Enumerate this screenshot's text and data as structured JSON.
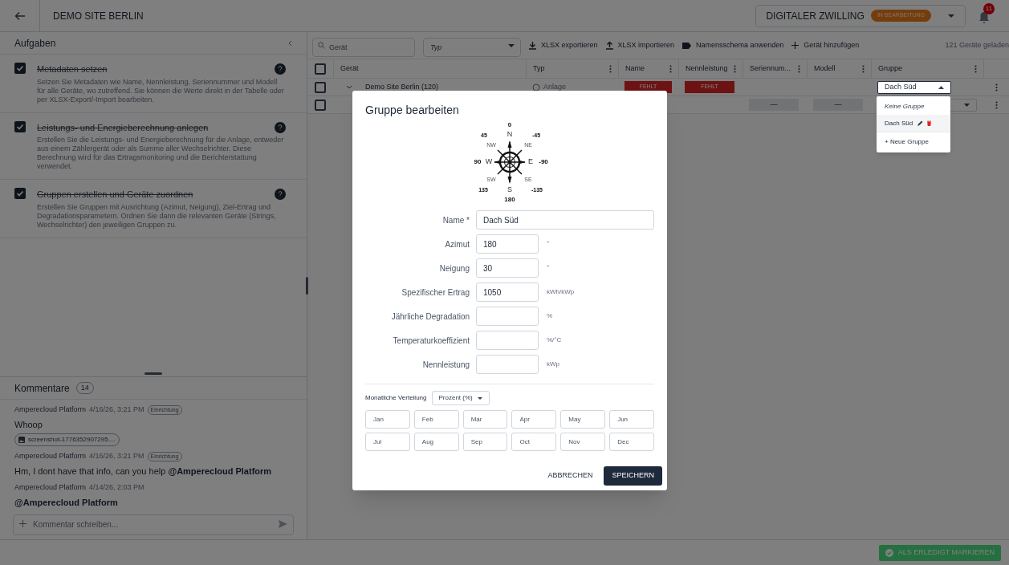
{
  "header": {
    "title": "DEMO SITE BERLIN",
    "twin_label": "DIGITALER ZWILLING",
    "twin_status": "IN BEARBEITUNG",
    "notifications": "11"
  },
  "tasks": {
    "title": "Aufgaben",
    "items": [
      {
        "title": "Metadaten setzen",
        "checked": true,
        "description": "Setzen Sie Metadaten wie Name, Nennleistung, Seriennummer und Modell für alle Geräte, wo zutreffend. Sie können die Werte direkt in der Tabelle oder per XLSX-Export/-Import bearbeiten."
      },
      {
        "title": "Leistungs- und Energieberechnung anlegen",
        "checked": true,
        "description": "Erstellen Sie die Leistungs- und Energieberechnung für die Anlage, entweder aus einem Zählergerät oder als Summe aller Wechselrichter. Diese Berechnung wird für das Ertragsmonitoring und die Berichterstattung verwendet."
      },
      {
        "title": "Gruppen erstellen und Geräte zuordnen",
        "checked": true,
        "description": "Erstellen Sie Gruppen mit Ausrichtung (Azimut, Neigung), Ziel-Ertrag und Degradationsparametern. Ordnen Sie dann die relevanten Geräte (Strings, Wechselrichter) den jeweiligen Gruppen zu."
      }
    ]
  },
  "comments": {
    "title": "Kommentare",
    "count": "14",
    "items": [
      {
        "author": "Amperecloud Platform",
        "time": "4/16/26, 3:21 PM",
        "tag": "Einrichtung",
        "text": "Whoop",
        "attachment": "screenshot-1776352907295...."
      },
      {
        "author": "Amperecloud Platform",
        "time": "4/16/26, 3:21 PM",
        "tag": "Einrichtung",
        "text": "Hm, I dont have that info, can you help **@Amperecloud Platform**"
      },
      {
        "author": "Amperecloud Platform",
        "time": "4/14/26, 2:03 PM",
        "text": "**@Amperecloud Platform**"
      }
    ],
    "input": {
      "placeholder": "Kommentar schreiben..."
    }
  },
  "toolbar": {
    "search": {
      "placeholder": "Gerät"
    },
    "type_filter": {
      "placeholder": "Typ"
    },
    "actions": [
      "XLSX exportieren",
      "XLSX importieren",
      "Namensschema anwenden",
      "Gerät hinzufügen"
    ],
    "status": "121 Geräte geladen"
  },
  "table": {
    "all_checked": false,
    "columns": [
      "Gerät",
      "Typ",
      "Name",
      "Nennleistung",
      "Seriennum...",
      "Modell",
      "Gruppe"
    ],
    "rows": [
      {
        "device": "Demo Site Berlin (120)",
        "type": "Anlage",
        "name": "FEHLT",
        "power": "FEHLT",
        "group": "Dach Süd",
        "checked": false
      },
      {
        "serial": "—",
        "model": "—",
        "checked": false
      }
    ]
  },
  "group_menu": {
    "items": [
      {
        "label": "Keine Gruppe",
        "kind": "none"
      },
      {
        "label": "Dach Süd",
        "kind": "group"
      },
      {
        "label": "+ Neue Gruppe",
        "kind": "add"
      }
    ]
  },
  "dialog": {
    "title": "Gruppe bearbeiten",
    "compass_labels": [
      "0",
      "45",
      "N",
      "-45",
      "NW",
      "NE",
      "90",
      "W",
      "E",
      "-90",
      "SW",
      "SE",
      "135",
      "S",
      "-135",
      "180"
    ],
    "fields": [
      {
        "label": "Name *",
        "value": "Dach Süd",
        "kind": "wide"
      },
      {
        "label": "Azimut",
        "value": "180",
        "unit": "°"
      },
      {
        "label": "Neigung",
        "value": "30",
        "unit": "°"
      },
      {
        "label": "Spezifischer Ertrag",
        "value": "1050",
        "unit": "kWh/kWp"
      },
      {
        "label": "Jährliche Degradation",
        "unit": "%"
      },
      {
        "label": "Temperaturkoeffizient",
        "unit": "%/°C"
      },
      {
        "label": "Nennleistung",
        "unit": "kWp"
      }
    ],
    "monthly_label": "Monatliche Verteilung",
    "monthly_unit": "Prozent (%)",
    "months": [
      {
        "placeholder": "Jan"
      },
      {
        "placeholder": "Feb"
      },
      {
        "placeholder": "Mar"
      },
      {
        "placeholder": "Apr"
      },
      {
        "placeholder": "May"
      },
      {
        "placeholder": "Jun"
      },
      {
        "placeholder": "Jul"
      },
      {
        "placeholder": "Aug"
      },
      {
        "placeholder": "Sep"
      },
      {
        "placeholder": "Oct"
      },
      {
        "placeholder": "Nov"
      },
      {
        "placeholder": "Dec"
      }
    ],
    "cancel": "ABBRECHEN",
    "save": "SPEICHERN"
  },
  "footer": {
    "done_button": "ALS ERLEDIGT MARKIEREN"
  }
}
